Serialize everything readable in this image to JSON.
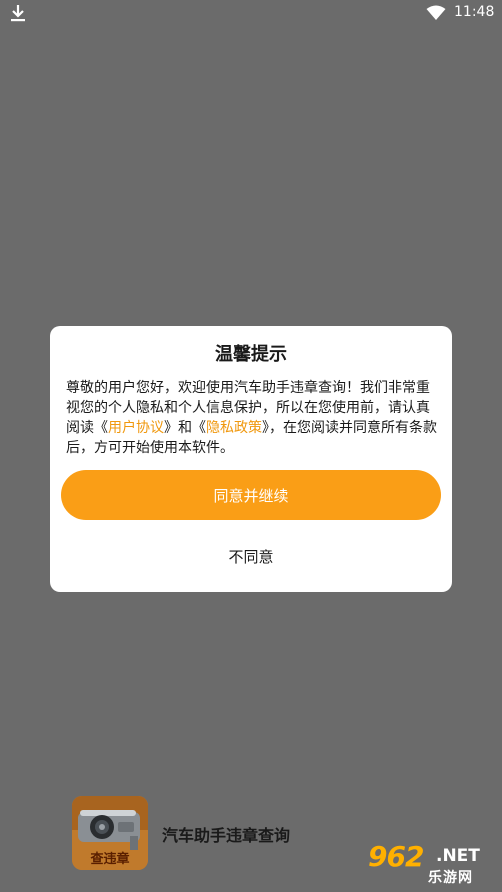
{
  "status_bar": {
    "time": "11:48",
    "left_icon": "download-icon",
    "right_icons": [
      "wifi-icon"
    ]
  },
  "dialog": {
    "title": "温馨提示",
    "body_part1": "尊敬的用户您好，欢迎使用汽车助手违章查询！我们非常重视您的个人隐私和个人信息保护，所以在您使用前，请认真阅读《",
    "user_agreement": "用户协议",
    "body_part2": "》和《",
    "privacy_policy": "隐私政策",
    "body_part3": "》，在您阅读并同意所有条款后，方可开始使用本软件。",
    "agree_label": "同意并继续",
    "disagree_label": "不同意"
  },
  "app": {
    "icon_label": "查违章",
    "name": "汽车助手违章查询"
  },
  "watermark": {
    "number": "962",
    "suffix": ".NET",
    "subtitle": "乐游网"
  },
  "colors": {
    "accent": "#fa9e16",
    "link": "#f0980e",
    "overlay": "#6b6b6b"
  }
}
